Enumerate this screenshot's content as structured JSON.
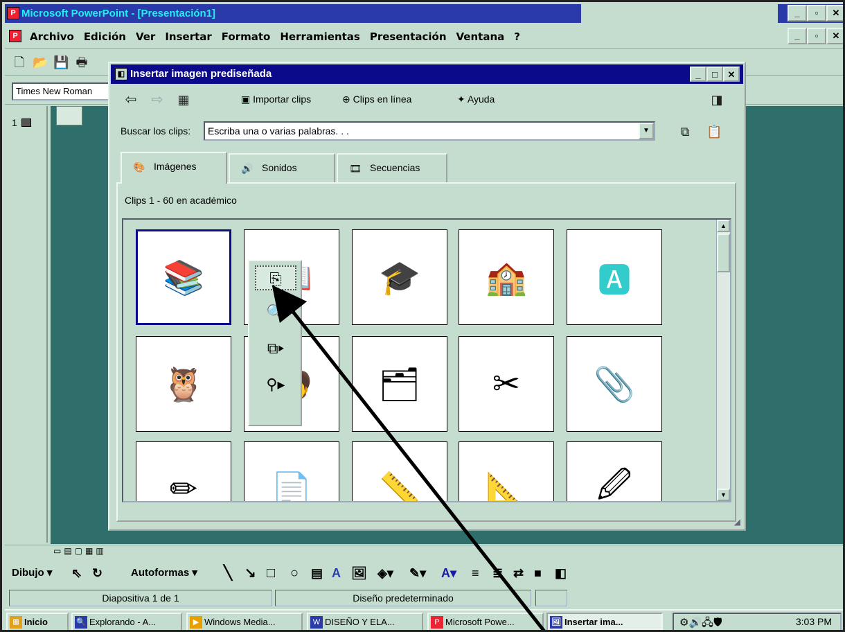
{
  "app": {
    "title": "Microsoft PowerPoint - [Presentación1]"
  },
  "menu": {
    "items": [
      "Archivo",
      "Edición",
      "Ver",
      "Insertar",
      "Formato",
      "Herramientas",
      "Presentación",
      "Ventana",
      "?"
    ]
  },
  "toolbar": {
    "font_name": "Times New Roman"
  },
  "slides_pane": {
    "slide_number": "1"
  },
  "dialog": {
    "title": "Insertar imagen prediseñada",
    "import_label": "Importar clips",
    "online_label": "Clips en línea",
    "help_label": "Ayuda",
    "search_label": "Buscar los clips:",
    "search_value": "Escriba una o varias palabras. . .",
    "tabs": [
      {
        "label": "Imágenes"
      },
      {
        "label": "Sonidos"
      },
      {
        "label": "Secuencias"
      }
    ],
    "results_label": "Clips 1 - 60 en académico"
  },
  "draw_toolbar": {
    "draw_label": "Dibujo",
    "autoshapes_label": "Autoformas"
  },
  "statusbar": {
    "slide_info": "Diapositiva 1 de 1",
    "design": "Diseño predeterminado"
  },
  "taskbar": {
    "start_label": "Inicio",
    "tasks": [
      {
        "label": "Explorando - A..."
      },
      {
        "label": "Windows Media..."
      },
      {
        "label": "DISEÑO Y ELA..."
      },
      {
        "label": "Microsoft Powe..."
      },
      {
        "label": "Insertar ima..."
      }
    ],
    "clock": "3:03 PM"
  }
}
